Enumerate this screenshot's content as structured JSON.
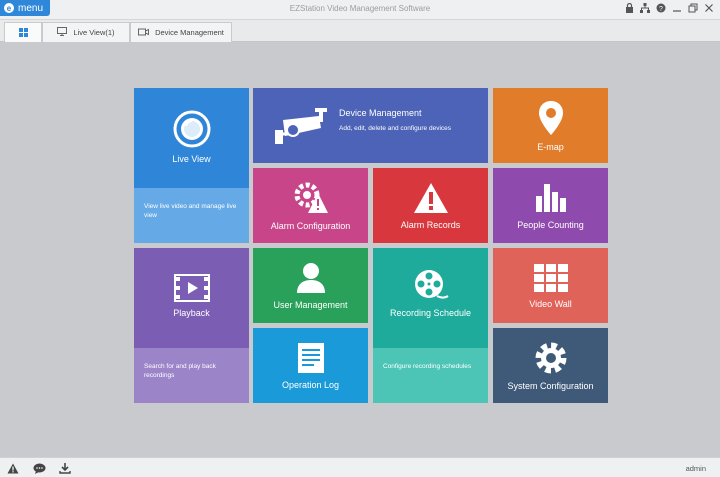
{
  "titlebar": {
    "menu_label": "menu",
    "app_title": "EZStation Video Management Software",
    "icons": [
      "lock-icon",
      "network-icon",
      "help-icon",
      "minimize-icon",
      "restore-icon",
      "close-icon"
    ]
  },
  "tabs": [
    {
      "label": "",
      "icon": "home-grid-icon"
    },
    {
      "label": "Live View(1)",
      "icon": "monitor-icon"
    },
    {
      "label": "Device Management",
      "icon": "camera-icon"
    }
  ],
  "tiles": {
    "live_view": {
      "label": "Live View",
      "desc": "View live video and manage live view",
      "color": "#2f85d7"
    },
    "device_management": {
      "label": "Device Management",
      "desc": "Add, edit, delete and configure devices",
      "color": "#4d63b8"
    },
    "emap": {
      "label": "E-map",
      "color": "#e17d2a"
    },
    "alarm_configuration": {
      "label": "Alarm Configuration",
      "color": "#c9458a"
    },
    "alarm_records": {
      "label": "Alarm Records",
      "color": "#d8373d"
    },
    "people_counting": {
      "label": "People Counting",
      "color": "#8f4aad"
    },
    "playback": {
      "label": "Playback",
      "desc": "Search for and play back recordings",
      "color": "#7b5eb3"
    },
    "user_management": {
      "label": "User Management",
      "color": "#2aa15a"
    },
    "recording_schedule": {
      "label": "Recording Schedule",
      "desc": "Configure recording schedules",
      "color": "#1eab9c"
    },
    "video_wall": {
      "label": "Video Wall",
      "color": "#e0635a"
    },
    "operation_log": {
      "label": "Operation Log",
      "color": "#1a9ad8"
    },
    "system_configuration": {
      "label": "System Configuration",
      "color": "#3f5a78"
    }
  },
  "statusbar": {
    "icons": [
      "alarm-warning-icon",
      "message-icon",
      "download-icon"
    ],
    "user": "admin"
  }
}
